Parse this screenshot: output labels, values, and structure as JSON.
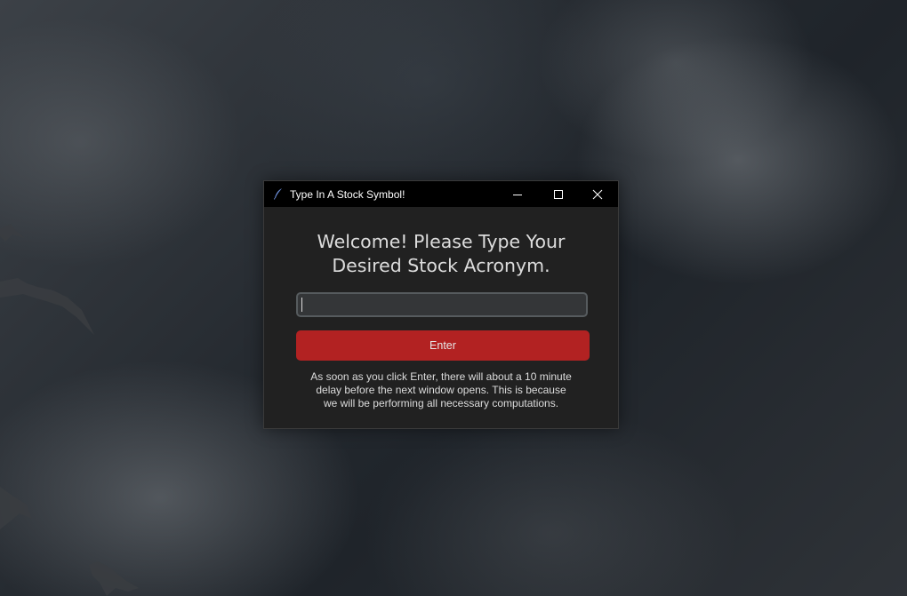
{
  "window": {
    "title": "Type In A Stock Symbol!",
    "controls": {
      "minimize": "minimize",
      "maximize": "maximize",
      "close": "close"
    }
  },
  "main": {
    "heading_lines": [
      "Welcome! Please Type Your",
      "Desired Stock Acronym."
    ],
    "input": {
      "value": "",
      "placeholder": ""
    },
    "enter_label": "Enter",
    "notice_lines": [
      "As soon as you click Enter, there will about a 10 minute",
      "delay before the next window opens. This is because",
      "we will be performing all necessary computations."
    ]
  },
  "colors": {
    "titlebar_bg": "#000000",
    "window_bg": "#212121",
    "input_bg": "#343638",
    "input_border": "#565b5e",
    "button_bg": "#b22222",
    "text": "#dcdcdc"
  },
  "icons": {
    "app": "feather-icon",
    "minimize": "minimize-icon",
    "maximize": "maximize-icon",
    "close": "close-icon"
  }
}
